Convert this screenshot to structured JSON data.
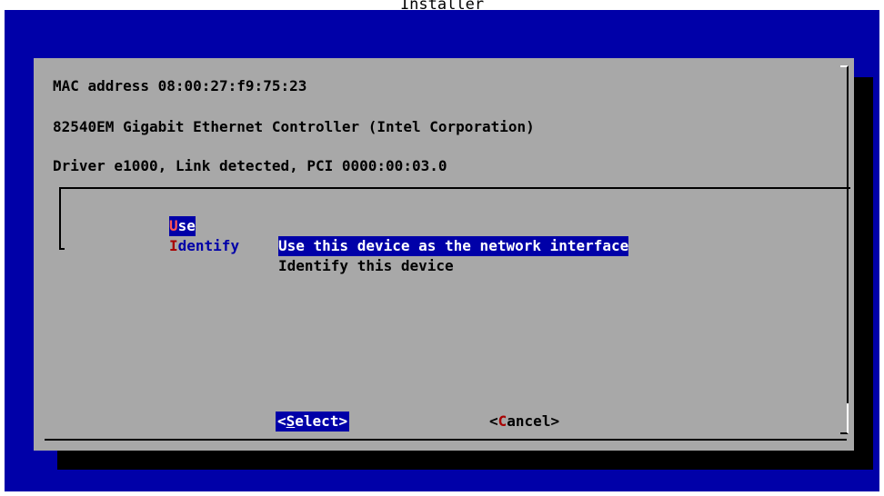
{
  "window": {
    "title": "Installer"
  },
  "colors": {
    "background": "#0000a8",
    "dialog": "#a8a8a8",
    "highlight": "#0000a8",
    "hotkey": "#a80000"
  },
  "dialog": {
    "mac_line": "MAC address 08:00:27:f9:75:23",
    "controller_line": "82540EM Gigabit Ethernet Controller (Intel Corporation)",
    "driver_line": "Driver e1000, Link detected, PCI 0000:00:03.0"
  },
  "menu": {
    "items": [
      {
        "hotkey": "U",
        "rest": "se",
        "description": "Use this device as the network interface",
        "selected": true
      },
      {
        "hotkey": "I",
        "rest": "dentify",
        "description": "Identify this device",
        "selected": false
      }
    ]
  },
  "buttons": {
    "select": {
      "open": "<",
      "hotkey": "S",
      "rest": "elect",
      "close": ">"
    },
    "cancel": {
      "open": "<",
      "hotkey": "C",
      "rest": "ancel",
      "close": ">"
    }
  }
}
